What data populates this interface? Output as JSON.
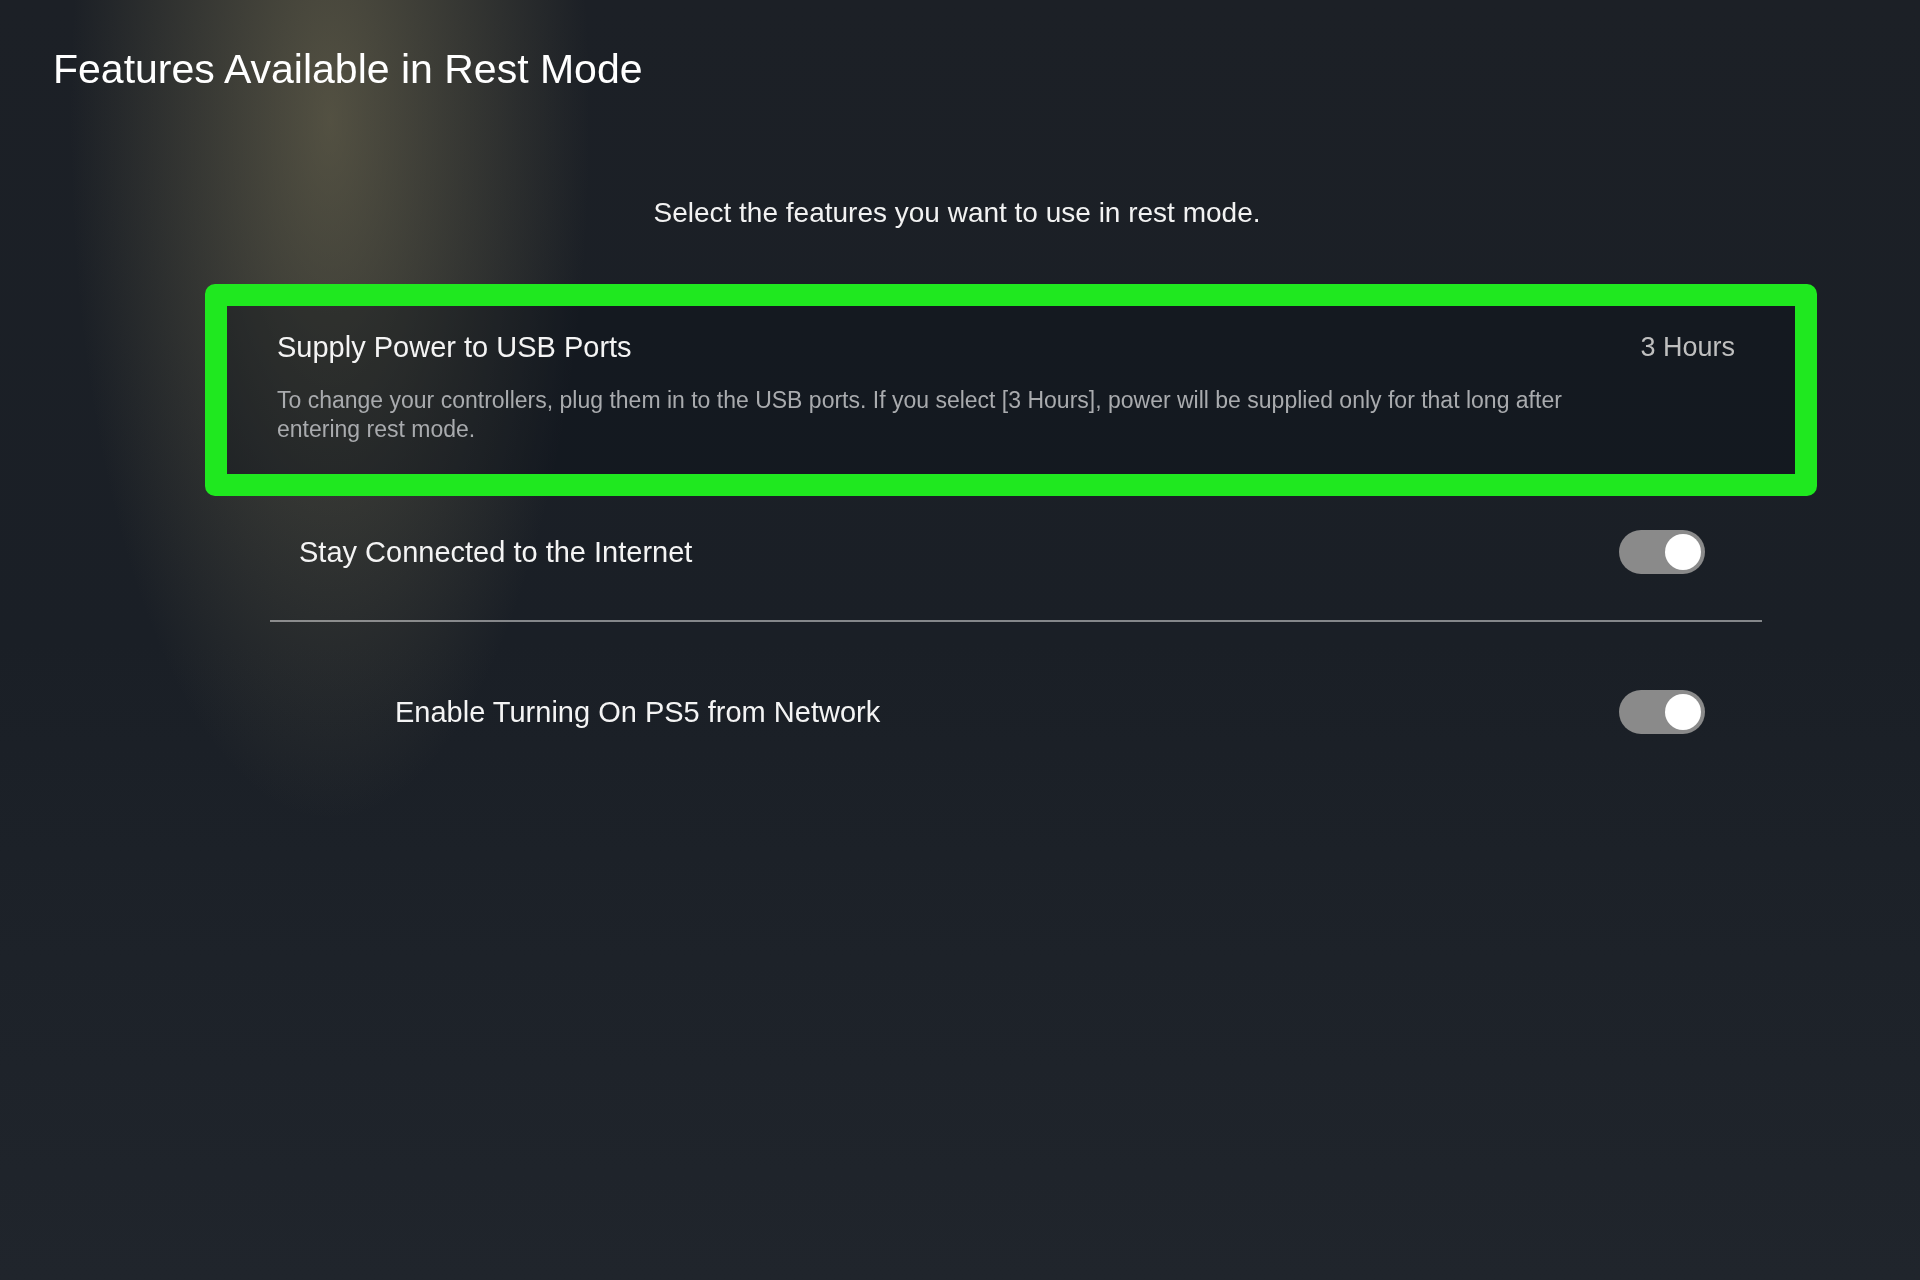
{
  "screen": {
    "title": "Features Available in Rest Mode",
    "subtitle": "Select the features you want to use in rest mode."
  },
  "settings": [
    {
      "kind": "value",
      "label": "Supply Power to USB Ports",
      "value": "3 Hours",
      "description": "To change your controllers, plug them in to the USB ports. If you select [3 Hours], power will be supplied only for that long after entering rest mode.",
      "highlighted": true
    },
    {
      "kind": "toggle",
      "label": "Stay Connected to the Internet",
      "on": true,
      "highlighted": false,
      "children": [
        {
          "kind": "toggle",
          "label": "Enable Turning On PS5 from Network",
          "on": true,
          "highlighted": false
        }
      ]
    }
  ]
}
